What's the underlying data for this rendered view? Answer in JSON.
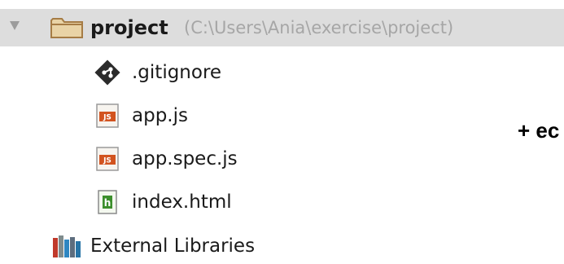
{
  "tree": {
    "root": {
      "label": "project",
      "path": "(C:\\Users\\Ania\\exercise\\project)",
      "icon": "folder-icon"
    },
    "files": [
      {
        "label": ".gitignore",
        "icon": "git-icon"
      },
      {
        "label": "app.js",
        "icon": "js-file-icon"
      },
      {
        "label": "app.spec.js",
        "icon": "js-file-icon"
      },
      {
        "label": "index.html",
        "icon": "html-file-icon"
      }
    ],
    "external": {
      "label": "External Libraries",
      "icon": "library-icon"
    }
  },
  "annotation": {
    "text": "+ ec"
  },
  "colors": {
    "selected_row": "#dddddd",
    "path_text": "#a6a6a6",
    "js_icon": "#d2531f",
    "html_icon": "#3c8f2c",
    "folder_icon": "#c89b5f"
  }
}
